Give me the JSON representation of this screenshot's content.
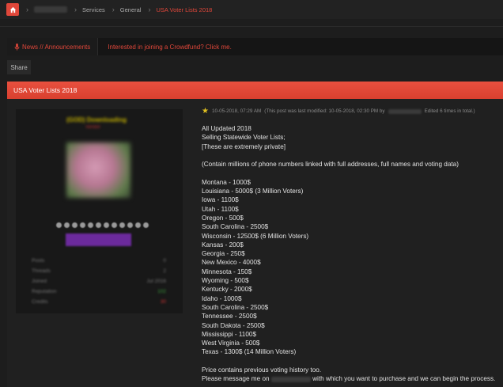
{
  "breadcrumb": {
    "items": [
      "Services",
      "General"
    ],
    "active": "USA Voter Lists 2018"
  },
  "announcement": {
    "label": "News // Announcements",
    "text": "Interested in joining a Crowdfund? Click me."
  },
  "share_label": "Share",
  "thread": {
    "title": "USA Voter Lists 2018"
  },
  "post": {
    "date": "10-05-2018, 07:29 AM",
    "modified": "(This post was last modified: 10-05-2018, 02:30 PM by",
    "edited": "Edited 6 times in total.)",
    "lines": [
      "All Updated 2018",
      "Selling Statewide Voter Lists;",
      "[These are extremely private]",
      "",
      "(Contain millions of phone numbers linked with full addresses, full names and voting data)",
      "",
      "Montana - 1000$",
      "Louisiana - 5000$ (3 Million Voters)",
      "Iowa - 1100$",
      "Utah - 1100$",
      "Oregon - 500$",
      "South Carolina - 2500$",
      "Wisconsin - 12500$ (6 Million Voters)",
      "Kansas - 200$",
      "Georgia - 250$",
      "New Mexico - 4000$",
      "Minnesota - 150$",
      "Wyoming - 500$",
      "Kentucky - 2000$",
      "Idaho - 1000$",
      "South Carolina - 2500$",
      "Tennessee - 2500$",
      "South Dakota - 2500$",
      "Mississippi - 1100$",
      "West Virginia - 500$",
      "Texas - 1300$ (14 Million Voters)",
      "",
      "Price contains previous voting history too."
    ],
    "last_line_a": "Please message me on",
    "last_line_b": "with which you want to purchase and we can begin the process."
  },
  "profile": {
    "username": "(GOD) Downloading",
    "title": "Vendor",
    "stats": [
      {
        "label": "Posts",
        "value": "0"
      },
      {
        "label": "Threads",
        "value": "2"
      },
      {
        "label": "Joined",
        "value": "Jul 2016"
      },
      {
        "label": "Reputation",
        "value": "102"
      },
      {
        "label": "Credits",
        "value": "30"
      }
    ]
  },
  "colors": {
    "accent": "#e0473a"
  }
}
